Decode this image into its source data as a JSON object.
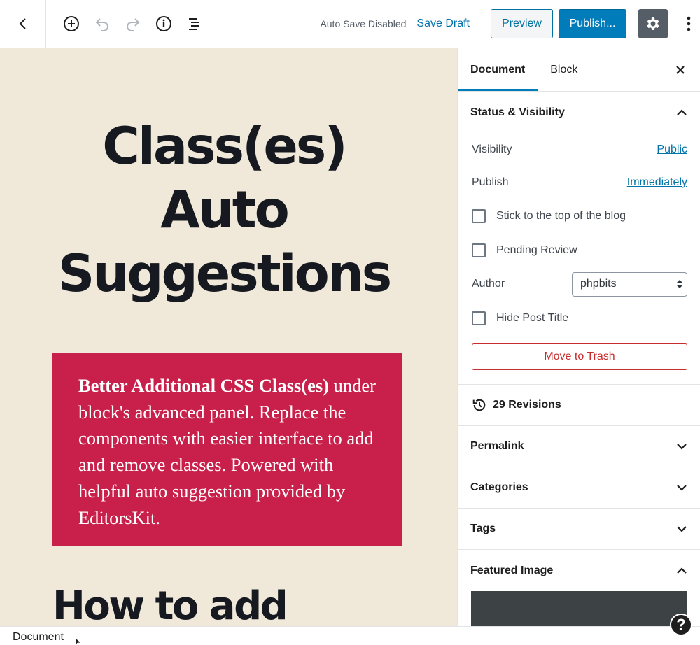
{
  "toolbar": {
    "autosave_status": "Auto Save Disabled",
    "save_draft_label": "Save Draft",
    "preview_label": "Preview",
    "publish_label": "Publish...",
    "icons": [
      "back-icon",
      "add-block-icon",
      "undo-icon",
      "redo-icon",
      "info-icon",
      "outline-icon",
      "settings-icon",
      "more-icon"
    ]
  },
  "editor": {
    "post_title_lines": [
      "Class(es)",
      "Auto",
      "Suggestions"
    ],
    "cover_bold": "Better Additional CSS Class(es)",
    "cover_text": " under block's advanced panel. Replace the components with easier interface to add and remove classes. Powered with helpful auto suggestion provided by EditorsKit.",
    "heading_preview": "How to add",
    "colors": {
      "canvas_bg": "#f0e9da",
      "cover_bg": "#c8204a"
    }
  },
  "sidebar": {
    "tabs": [
      {
        "label": "Document",
        "active": true
      },
      {
        "label": "Block",
        "active": false
      }
    ],
    "status_panel": {
      "title": "Status & Visibility",
      "visibility_label": "Visibility",
      "visibility_value": "Public",
      "publish_label": "Publish",
      "publish_value": "Immediately",
      "stick_label": "Stick to the top of the blog",
      "pending_label": "Pending Review",
      "author_label": "Author",
      "author_value": "phpbits",
      "hide_title_label": "Hide Post Title",
      "trash_label": "Move to Trash"
    },
    "revisions_label": "29 Revisions",
    "panels": [
      {
        "title": "Permalink"
      },
      {
        "title": "Categories"
      },
      {
        "title": "Tags"
      },
      {
        "title": "Featured Image"
      }
    ]
  },
  "footer": {
    "breadcrumb": "Document",
    "help_label": "?"
  }
}
